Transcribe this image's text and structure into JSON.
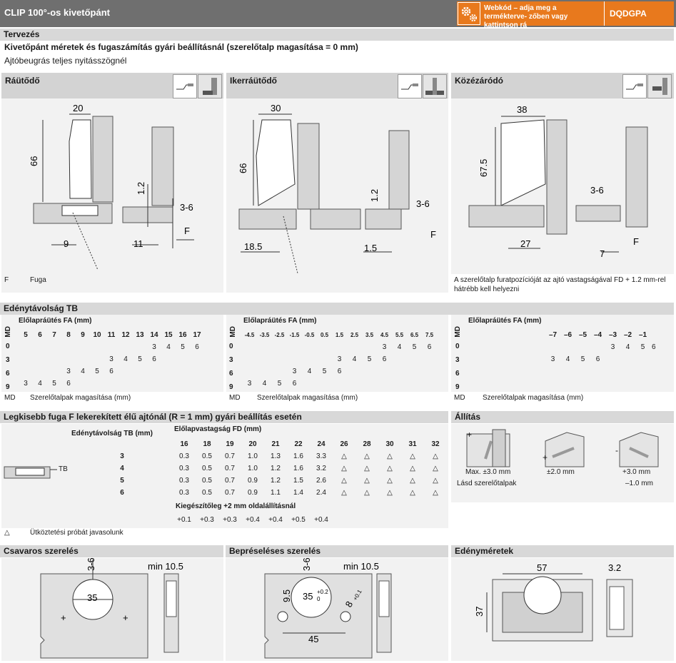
{
  "header": {
    "title": "CLIP 100°-os kivetőpánt",
    "web_text": "Webkód – adja meg a termékterve- zőben vagy kattintson rá",
    "code": "DQDGPA",
    "gear_icon": "gear-icon",
    "accent": "#e8791d"
  },
  "tervezes": {
    "section": "Tervezés",
    "line1": "Kivetőpánt méretek és fugaszámítás gyári beállításnál (szerelőtalp magasítása = 0 mm)",
    "line2": "Ajtóbeugrás teljes nyitásszögnél"
  },
  "panels": [
    {
      "title": "Ráütődő",
      "dims": {
        "d20": "20",
        "d66": "66",
        "d12": "1.2",
        "d36": "3-6",
        "d9": "9",
        "d11": "11",
        "F": "F"
      }
    },
    {
      "title": "Ikerráütődő",
      "dims": {
        "d30": "30",
        "d66": "66",
        "d12": "1.2",
        "d36": "3-6",
        "d185": "18.5",
        "d15": "1.5",
        "F": "F"
      }
    },
    {
      "title": "Közézáródó",
      "dims": {
        "d38": "38",
        "d675": "67.5",
        "d36": "3-6",
        "d27": "27",
        "d7": "7",
        "F": "F"
      }
    }
  ],
  "fuga": {
    "code": "F",
    "label": "Fuga"
  },
  "kozezarodo_note": "A szerelőtalp furatpozícióját az ajtó vastagságával FD + 1.2 mm-rel hátrébb kell helyezni",
  "tb": {
    "section": "Edénytávolság TB",
    "fa_label": "Előlapráütés FA (mm)",
    "md": "MD",
    "md_label": "Szerelőtalpak magasítása (mm)",
    "t1": {
      "cols": [
        "5",
        "6",
        "7",
        "8",
        "9",
        "10",
        "11",
        "12",
        "13",
        "14",
        "15",
        "16",
        "17"
      ],
      "rows": [
        {
          "md": "0",
          "cells": [
            "",
            "",
            "",
            "",
            "",
            "",
            "",
            "",
            "",
            "3",
            "4",
            "5",
            "6"
          ]
        },
        {
          "md": "3",
          "cells": [
            "",
            "",
            "",
            "",
            "",
            "",
            "3",
            "4",
            "5",
            "6",
            "",
            "",
            ""
          ]
        },
        {
          "md": "6",
          "cells": [
            "",
            "",
            "",
            "3",
            "4",
            "5",
            "6",
            "",
            "",
            "",
            "",
            "",
            ""
          ]
        },
        {
          "md": "9",
          "cells": [
            "3",
            "4",
            "5",
            "6",
            "",
            "",
            "",
            "",
            "",
            "",
            "",
            "",
            ""
          ]
        }
      ]
    },
    "t2": {
      "cols": [
        "-4.5",
        "-3.5",
        "-2.5",
        "-1.5",
        "-0.5",
        "0.5",
        "1.5",
        "2.5",
        "3.5",
        "4.5",
        "5.5",
        "6.5",
        "7.5"
      ],
      "rows": [
        {
          "md": "0",
          "cells": [
            "",
            "",
            "",
            "",
            "",
            "",
            "",
            "",
            "",
            "3",
            "4",
            "5",
            "6"
          ]
        },
        {
          "md": "3",
          "cells": [
            "",
            "",
            "",
            "",
            "",
            "",
            "3",
            "4",
            "5",
            "6",
            "",
            "",
            ""
          ]
        },
        {
          "md": "6",
          "cells": [
            "",
            "",
            "",
            "3",
            "4",
            "5",
            "6",
            "",
            "",
            "",
            "",
            "",
            ""
          ]
        },
        {
          "md": "9",
          "cells": [
            "3",
            "4",
            "5",
            "6",
            "",
            "",
            "",
            "",
            "",
            "",
            "",
            "",
            ""
          ]
        }
      ]
    },
    "t3": {
      "cols": [
        "–7",
        "–6",
        "–5",
        "–4",
        "–3",
        "–2",
        "–1"
      ],
      "rows": [
        {
          "md": "0",
          "cells": [
            "",
            "",
            "",
            "",
            "3",
            "4",
            "5",
            "6"
          ]
        },
        {
          "md": "3",
          "cells": [
            "3",
            "4",
            "5",
            "6",
            "",
            "",
            "",
            ""
          ]
        },
        {
          "md": "6",
          "cells": [
            "",
            "",
            "",
            "",
            "",
            "",
            "",
            ""
          ]
        },
        {
          "md": "9",
          "cells": [
            "",
            "",
            "",
            "",
            "",
            "",
            "",
            ""
          ]
        }
      ]
    }
  },
  "legkisebb": {
    "section": "Legkisebb fuga F lekerekített élű ajtónál (R = 1 mm) gyári beállítás esetén",
    "tb_col": "Edénytávolság TB (mm)",
    "fd_label": "Előlapvastagság FD (mm)",
    "fd": [
      "16",
      "18",
      "19",
      "20",
      "21",
      "22",
      "24",
      "26",
      "28",
      "30",
      "31",
      "32"
    ],
    "rows": [
      {
        "tb": "3",
        "vals": [
          "0.3",
          "0.5",
          "0.7",
          "1.0",
          "1.3",
          "1.6",
          "3.3",
          "△",
          "△",
          "△",
          "△",
          "△"
        ]
      },
      {
        "tb": "4",
        "vals": [
          "0.3",
          "0.5",
          "0.7",
          "1.0",
          "1.2",
          "1.6",
          "3.2",
          "△",
          "△",
          "△",
          "△",
          "△"
        ]
      },
      {
        "tb": "5",
        "vals": [
          "0.3",
          "0.5",
          "0.7",
          "0.9",
          "1.2",
          "1.5",
          "2.6",
          "△",
          "△",
          "△",
          "△",
          "△"
        ]
      },
      {
        "tb": "6",
        "vals": [
          "0.3",
          "0.5",
          "0.7",
          "0.9",
          "1.1",
          "1.4",
          "2.4",
          "△",
          "△",
          "△",
          "△",
          "△"
        ]
      }
    ],
    "kieg_label": "Kiegészítőleg +2 mm oldalállításnál",
    "kieg": [
      "+0.1",
      "+0.3",
      "+0.3",
      "+0.4",
      "+0.4",
      "+0.5",
      "+0.4"
    ],
    "tb_tag": "TB",
    "note_sym": "△",
    "note": "Ütköztetési próbát javasolunk"
  },
  "allitas": {
    "section": "Állítás",
    "c1a": "Max. ±3.0 mm",
    "c1b": "Lásd szerelőtalpak",
    "c2": "±2.0 mm",
    "c3a": "+3.0 mm",
    "c3b": "–1.0 mm",
    "plus": "+",
    "minus": "-",
    "one": "1"
  },
  "bottom": {
    "csavaros": {
      "title": "Csavaros szerelés",
      "d36": "3-6",
      "min": "min 10.5",
      "d35": "35"
    },
    "bepreseleses": {
      "title": "Bepréseléses szerelés",
      "d36": "3-6",
      "min": "min 10.5",
      "d35": "35",
      "sup": "+0.2",
      "sub": "0",
      "d95": "9.5",
      "d45": "45",
      "d8": "8",
      "d8sup": "+0.1"
    },
    "edeny": {
      "title": "Edényméretek",
      "d57": "57",
      "d32": "3.2",
      "d37": "37"
    }
  }
}
